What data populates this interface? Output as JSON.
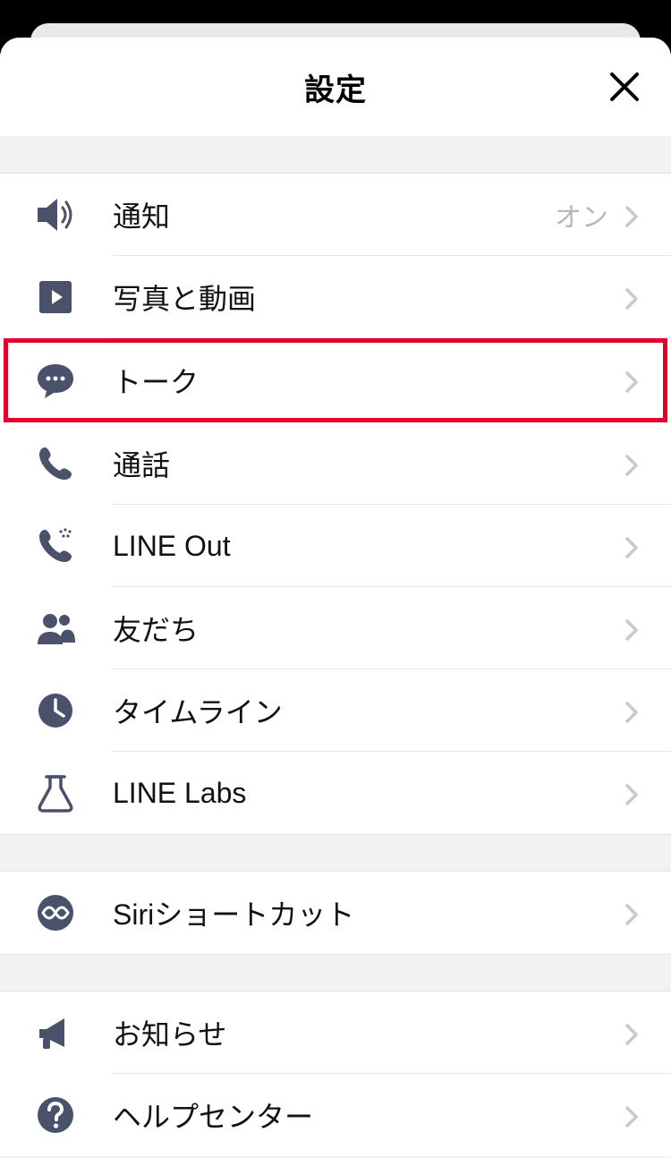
{
  "header": {
    "title": "設定"
  },
  "sections": [
    {
      "items": [
        {
          "key": "notifications",
          "label": "通知",
          "value": "オン",
          "icon": "speaker-icon",
          "highlight": false
        },
        {
          "key": "photos-videos",
          "label": "写真と動画",
          "value": "",
          "icon": "play-square-icon",
          "highlight": false
        },
        {
          "key": "talk",
          "label": "トーク",
          "value": "",
          "icon": "chat-bubble-icon",
          "highlight": true
        },
        {
          "key": "call",
          "label": "通話",
          "value": "",
          "icon": "phone-icon",
          "highlight": false
        },
        {
          "key": "line-out",
          "label": "LINE Out",
          "value": "",
          "icon": "phone-out-icon",
          "highlight": false
        },
        {
          "key": "friends",
          "label": "友だち",
          "value": "",
          "icon": "people-icon",
          "highlight": false
        },
        {
          "key": "timeline",
          "label": "タイムライン",
          "value": "",
          "icon": "clock-icon",
          "highlight": false
        },
        {
          "key": "line-labs",
          "label": "LINE Labs",
          "value": "",
          "icon": "flask-icon",
          "highlight": false
        }
      ]
    },
    {
      "items": [
        {
          "key": "siri-shortcuts",
          "label": "Siriショートカット",
          "value": "",
          "icon": "siri-icon",
          "highlight": false
        }
      ]
    },
    {
      "items": [
        {
          "key": "announcements",
          "label": "お知らせ",
          "value": "",
          "icon": "megaphone-icon",
          "highlight": false
        },
        {
          "key": "help-center",
          "label": "ヘルプセンター",
          "value": "",
          "icon": "help-icon",
          "highlight": false
        }
      ]
    }
  ],
  "colors": {
    "icon": "#4a516b",
    "highlight": "#e3002b",
    "chevron": "#c9c9c9",
    "value": "#b8b8b8"
  }
}
